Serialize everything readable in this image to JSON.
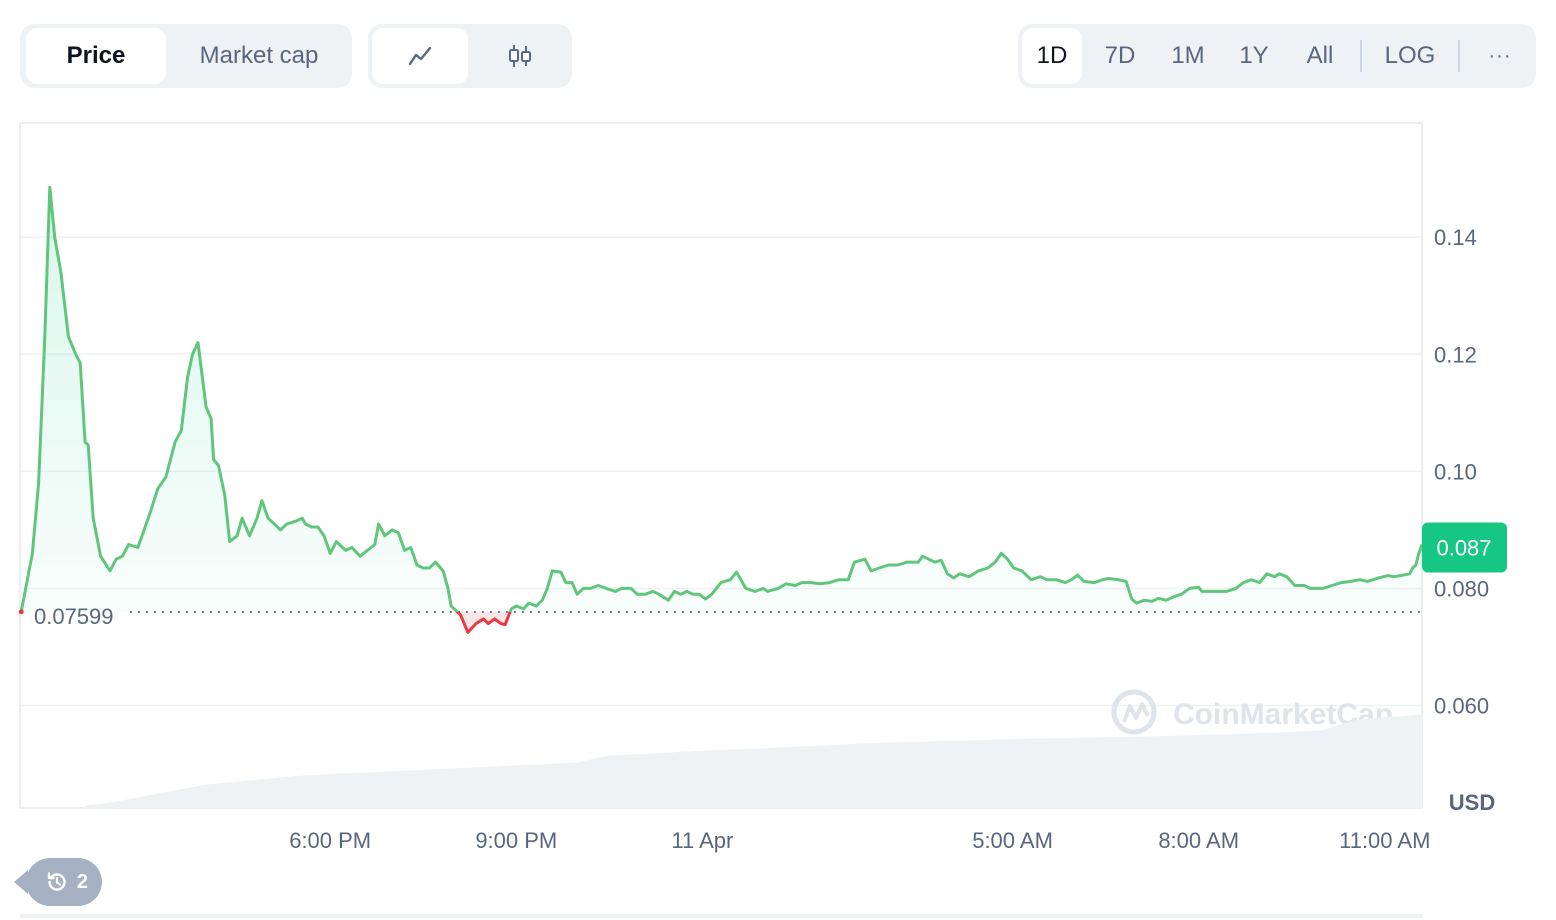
{
  "toolbar": {
    "view_tabs": [
      {
        "label": "Price",
        "active": true
      },
      {
        "label": "Market cap",
        "active": false
      }
    ],
    "chart_type_tabs": [
      {
        "icon": "line-chart-icon",
        "active": true
      },
      {
        "icon": "candlestick-icon",
        "active": false
      }
    ],
    "ranges": [
      {
        "label": "1D",
        "active": true
      },
      {
        "label": "7D",
        "active": false
      },
      {
        "label": "1M",
        "active": false
      },
      {
        "label": "1Y",
        "active": false
      },
      {
        "label": "All",
        "active": false
      }
    ],
    "log_label": "LOG",
    "more_label": "···"
  },
  "history": {
    "count": "2",
    "icon": "history-icon"
  },
  "watermark": "CoinMarketCap",
  "colors": {
    "up": "#16c784",
    "up_line": "#5fc67b",
    "down": "#ea3943",
    "grid": "#eff2f5",
    "volume": "#eff2f5",
    "label": "#58667e"
  },
  "chart_data": {
    "type": "line",
    "currency_label": "USD",
    "baseline_value": 0.07599,
    "baseline_label": "0.07599",
    "current_value": 0.087,
    "current_label": "0.087",
    "y_ticks": [
      0.06,
      0.08,
      0.1,
      0.12,
      0.14
    ],
    "y_tick_labels": [
      "0.060",
      "0.080",
      "0.10",
      "0.12",
      "0.14"
    ],
    "ylim": [
      0.0425,
      0.1595
    ],
    "x_ticks": [
      {
        "hour": 6,
        "label": "6:00 PM"
      },
      {
        "hour": 9,
        "label": "9:00 PM"
      },
      {
        "hour": 12,
        "label": "11 Apr"
      },
      {
        "hour": 17,
        "label": "5:00 AM"
      },
      {
        "hour": 20,
        "label": "8:00 AM"
      },
      {
        "hour": 23,
        "label": "11:00 AM"
      }
    ],
    "xlim": [
      1.0,
      23.6
    ],
    "series": [
      {
        "points": [
          [
            1.02,
            0.076
          ],
          [
            1.2,
            0.086
          ],
          [
            1.3,
            0.098
          ],
          [
            1.4,
            0.123
          ],
          [
            1.48,
            0.1485
          ],
          [
            1.56,
            0.14
          ],
          [
            1.66,
            0.134
          ],
          [
            1.78,
            0.123
          ],
          [
            1.9,
            0.12
          ],
          [
            1.97,
            0.1185
          ],
          [
            2.05,
            0.105
          ],
          [
            2.1,
            0.1045
          ],
          [
            2.18,
            0.092
          ],
          [
            2.3,
            0.0855
          ],
          [
            2.45,
            0.083
          ],
          [
            2.55,
            0.085
          ],
          [
            2.65,
            0.0855
          ],
          [
            2.75,
            0.0875
          ],
          [
            2.9,
            0.087
          ],
          [
            3.0,
            0.09
          ],
          [
            3.1,
            0.093
          ],
          [
            3.22,
            0.097
          ],
          [
            3.35,
            0.099
          ],
          [
            3.5,
            0.105
          ],
          [
            3.6,
            0.107
          ],
          [
            3.7,
            0.116
          ],
          [
            3.78,
            0.12
          ],
          [
            3.87,
            0.122
          ],
          [
            4.0,
            0.111
          ],
          [
            4.08,
            0.109
          ],
          [
            4.12,
            0.102
          ],
          [
            4.2,
            0.101
          ],
          [
            4.3,
            0.096
          ],
          [
            4.38,
            0.088
          ],
          [
            4.5,
            0.089
          ],
          [
            4.58,
            0.092
          ],
          [
            4.7,
            0.089
          ],
          [
            4.82,
            0.092
          ],
          [
            4.9,
            0.095
          ],
          [
            5.0,
            0.092
          ],
          [
            5.1,
            0.091
          ],
          [
            5.2,
            0.09
          ],
          [
            5.3,
            0.091
          ],
          [
            5.45,
            0.0915
          ],
          [
            5.55,
            0.092
          ],
          [
            5.6,
            0.091
          ],
          [
            5.7,
            0.0905
          ],
          [
            5.8,
            0.0905
          ],
          [
            5.9,
            0.089
          ],
          [
            6.0,
            0.086
          ],
          [
            6.1,
            0.088
          ],
          [
            6.25,
            0.0865
          ],
          [
            6.35,
            0.087
          ],
          [
            6.48,
            0.0855
          ],
          [
            6.6,
            0.0865
          ],
          [
            6.72,
            0.0875
          ],
          [
            6.78,
            0.091
          ],
          [
            6.88,
            0.089
          ],
          [
            7.0,
            0.09
          ],
          [
            7.1,
            0.0895
          ],
          [
            7.2,
            0.0865
          ],
          [
            7.3,
            0.087
          ],
          [
            7.4,
            0.084
          ],
          [
            7.5,
            0.0835
          ],
          [
            7.6,
            0.0835
          ],
          [
            7.7,
            0.0845
          ],
          [
            7.82,
            0.083
          ],
          [
            7.9,
            0.08
          ],
          [
            7.95,
            0.077
          ],
          [
            8.1,
            0.0755
          ],
          [
            8.22,
            0.0725
          ],
          [
            8.35,
            0.074
          ],
          [
            8.47,
            0.0748
          ],
          [
            8.55,
            0.074
          ],
          [
            8.65,
            0.0748
          ],
          [
            8.75,
            0.074
          ],
          [
            8.82,
            0.0738
          ],
          [
            8.92,
            0.0765
          ],
          [
            9.0,
            0.077
          ],
          [
            9.12,
            0.0765
          ],
          [
            9.2,
            0.0775
          ],
          [
            9.32,
            0.077
          ],
          [
            9.42,
            0.078
          ],
          [
            9.5,
            0.08
          ],
          [
            9.58,
            0.083
          ],
          [
            9.72,
            0.0828
          ],
          [
            9.8,
            0.081
          ],
          [
            9.9,
            0.081
          ],
          [
            9.98,
            0.079
          ],
          [
            10.08,
            0.08
          ],
          [
            10.2,
            0.08
          ],
          [
            10.32,
            0.0805
          ],
          [
            10.45,
            0.08
          ],
          [
            10.6,
            0.0795
          ],
          [
            10.7,
            0.08
          ],
          [
            10.85,
            0.08
          ],
          [
            10.95,
            0.079
          ],
          [
            11.08,
            0.079
          ],
          [
            11.2,
            0.0795
          ],
          [
            11.3,
            0.079
          ],
          [
            11.45,
            0.078
          ],
          [
            11.55,
            0.0795
          ],
          [
            11.65,
            0.079
          ],
          [
            11.75,
            0.0795
          ],
          [
            11.85,
            0.079
          ],
          [
            11.95,
            0.079
          ],
          [
            12.05,
            0.0782
          ],
          [
            12.15,
            0.079
          ],
          [
            12.3,
            0.081
          ],
          [
            12.45,
            0.0815
          ],
          [
            12.55,
            0.0828
          ],
          [
            12.7,
            0.08
          ],
          [
            12.85,
            0.0795
          ],
          [
            12.98,
            0.08
          ],
          [
            13.05,
            0.0795
          ],
          [
            13.22,
            0.08
          ],
          [
            13.35,
            0.0808
          ],
          [
            13.5,
            0.0805
          ],
          [
            13.6,
            0.081
          ],
          [
            13.75,
            0.081
          ],
          [
            13.9,
            0.0808
          ],
          [
            14.05,
            0.081
          ],
          [
            14.2,
            0.0815
          ],
          [
            14.35,
            0.0815
          ],
          [
            14.45,
            0.0845
          ],
          [
            14.62,
            0.085
          ],
          [
            14.72,
            0.083
          ],
          [
            14.85,
            0.0835
          ],
          [
            15.0,
            0.084
          ],
          [
            15.15,
            0.084
          ],
          [
            15.3,
            0.0845
          ],
          [
            15.48,
            0.0845
          ],
          [
            15.55,
            0.0855
          ],
          [
            15.65,
            0.085
          ],
          [
            15.75,
            0.0845
          ],
          [
            15.85,
            0.0848
          ],
          [
            15.95,
            0.0825
          ],
          [
            16.05,
            0.0818
          ],
          [
            16.15,
            0.0825
          ],
          [
            16.3,
            0.082
          ],
          [
            16.45,
            0.083
          ],
          [
            16.6,
            0.0835
          ],
          [
            16.72,
            0.0845
          ],
          [
            16.82,
            0.086
          ],
          [
            16.92,
            0.085
          ],
          [
            17.02,
            0.0835
          ],
          [
            17.15,
            0.083
          ],
          [
            17.3,
            0.0815
          ],
          [
            17.45,
            0.082
          ],
          [
            17.55,
            0.0815
          ],
          [
            17.7,
            0.0815
          ],
          [
            17.85,
            0.081
          ],
          [
            17.95,
            0.0815
          ],
          [
            18.05,
            0.0823
          ],
          [
            18.15,
            0.0812
          ],
          [
            18.32,
            0.081
          ],
          [
            18.45,
            0.0815
          ],
          [
            18.55,
            0.0817
          ],
          [
            18.7,
            0.0815
          ],
          [
            18.83,
            0.0812
          ],
          [
            18.92,
            0.0782
          ],
          [
            19.0,
            0.0775
          ],
          [
            19.12,
            0.078
          ],
          [
            19.25,
            0.0778
          ],
          [
            19.35,
            0.0783
          ],
          [
            19.48,
            0.078
          ],
          [
            19.58,
            0.0785
          ],
          [
            19.72,
            0.079
          ],
          [
            19.85,
            0.08
          ],
          [
            20.0,
            0.0802
          ],
          [
            20.05,
            0.0795
          ],
          [
            20.15,
            0.0795
          ],
          [
            20.3,
            0.0795
          ],
          [
            20.45,
            0.0795
          ],
          [
            20.6,
            0.08
          ],
          [
            20.72,
            0.081
          ],
          [
            20.85,
            0.0815
          ],
          [
            20.98,
            0.081
          ],
          [
            21.1,
            0.0825
          ],
          [
            21.22,
            0.082
          ],
          [
            21.3,
            0.0825
          ],
          [
            21.42,
            0.082
          ],
          [
            21.55,
            0.0805
          ],
          [
            21.7,
            0.0805
          ],
          [
            21.8,
            0.08
          ],
          [
            22.0,
            0.08
          ],
          [
            22.15,
            0.0805
          ],
          [
            22.3,
            0.081
          ],
          [
            22.45,
            0.0812
          ],
          [
            22.6,
            0.0815
          ],
          [
            22.72,
            0.0812
          ],
          [
            22.9,
            0.0818
          ],
          [
            23.05,
            0.0822
          ],
          [
            23.15,
            0.082
          ],
          [
            23.3,
            0.0823
          ],
          [
            23.4,
            0.0825
          ],
          [
            23.45,
            0.0835
          ],
          [
            23.5,
            0.084
          ],
          [
            23.55,
            0.086
          ],
          [
            23.6,
            0.0875
          ]
        ]
      }
    ],
    "volume": {
      "points": [
        [
          1.0,
          0.0
        ],
        [
          2.0,
          0.0
        ],
        [
          2.1,
          0.0005
        ],
        [
          2.5,
          0.001
        ],
        [
          3.0,
          0.002
        ],
        [
          3.5,
          0.003
        ],
        [
          4.0,
          0.004
        ],
        [
          4.5,
          0.0045
        ],
        [
          5.0,
          0.005
        ],
        [
          5.5,
          0.0055
        ],
        [
          6.0,
          0.0058
        ],
        [
          6.5,
          0.006
        ],
        [
          7.0,
          0.0063
        ],
        [
          7.5,
          0.0065
        ],
        [
          8.0,
          0.0068
        ],
        [
          8.5,
          0.007
        ],
        [
          9.0,
          0.0073
        ],
        [
          9.5,
          0.0075
        ],
        [
          10.0,
          0.0078
        ],
        [
          10.5,
          0.009
        ],
        [
          11.0,
          0.0092
        ],
        [
          11.5,
          0.0095
        ],
        [
          12.0,
          0.0098
        ],
        [
          12.5,
          0.01
        ],
        [
          13.0,
          0.0102
        ],
        [
          13.5,
          0.0105
        ],
        [
          14.0,
          0.0107
        ],
        [
          14.5,
          0.011
        ],
        [
          15.0,
          0.0112
        ],
        [
          15.5,
          0.0113
        ],
        [
          16.0,
          0.0115
        ],
        [
          16.5,
          0.0116
        ],
        [
          17.0,
          0.0118
        ],
        [
          17.5,
          0.0119
        ],
        [
          18.0,
          0.012
        ],
        [
          18.5,
          0.0121
        ],
        [
          19.0,
          0.0122
        ],
        [
          19.5,
          0.0123
        ],
        [
          20.0,
          0.0125
        ],
        [
          20.5,
          0.0126
        ],
        [
          21.0,
          0.0128
        ],
        [
          21.5,
          0.013
        ],
        [
          22.0,
          0.0133
        ],
        [
          22.5,
          0.015
        ],
        [
          23.0,
          0.0155
        ],
        [
          23.6,
          0.016
        ]
      ]
    }
  }
}
